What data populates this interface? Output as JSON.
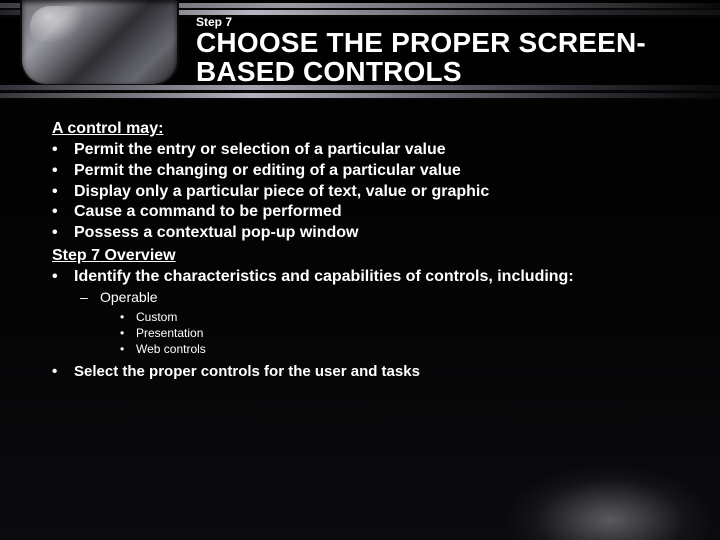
{
  "meta": {
    "step_label": "Step 7",
    "title": "CHOOSE THE PROPER SCREEN-BASED CONTROLS"
  },
  "body": {
    "heading1": "A control may:",
    "bullets1": [
      "Permit the entry or selection of a particular value",
      "Permit the changing or editing of a particular value",
      "Display only a particular piece of text, value or graphic",
      "Cause a command to be performed",
      "Possess a contextual pop-up window"
    ],
    "heading2": "Step 7 Overview",
    "bullets2": [
      "Identify the characteristics and capabilities of controls, including:"
    ],
    "sub1": [
      "Operable"
    ],
    "sub2": [
      "Custom",
      "Presentation",
      "Web controls"
    ],
    "final": [
      "Select the proper controls for the user and tasks"
    ]
  }
}
